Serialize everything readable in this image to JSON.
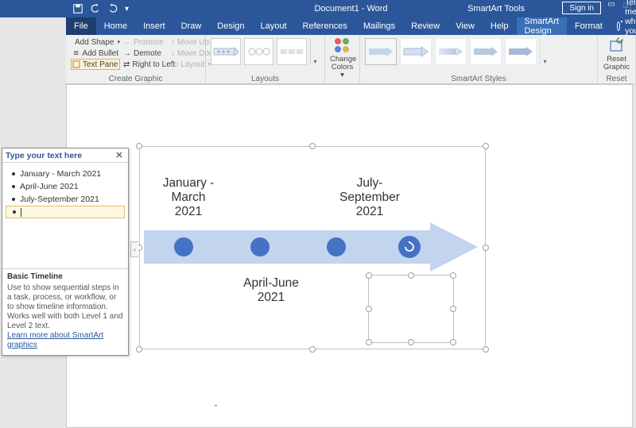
{
  "titlebar": {
    "doc_title": "Document1 - Word",
    "smartart_tools": "SmartArt Tools",
    "sign_in": "Sign in"
  },
  "tabs": {
    "file": "File",
    "items": [
      "Home",
      "Insert",
      "Draw",
      "Design",
      "Layout",
      "References",
      "Mailings",
      "Review",
      "View",
      "Help"
    ],
    "contextual": [
      "SmartArt Design",
      "Format"
    ],
    "tell_me": "Tell me what you want to do"
  },
  "ribbon": {
    "create_graphic": {
      "add_shape": "Add Shape",
      "add_bullet": "Add Bullet",
      "text_pane": "Text Pane",
      "promote": "Promote",
      "demote": "Demote",
      "right_to_left": "Right to Left",
      "move_up": "Move Up",
      "move_down": "Move Down",
      "layout": "Layout",
      "label": "Create Graphic"
    },
    "layouts_label": "Layouts",
    "change_colors": {
      "line1": "Change",
      "line2": "Colors"
    },
    "smartart_styles_label": "SmartArt Styles",
    "reset": {
      "line1": "Reset",
      "line2": "Graphic",
      "label": "Reset"
    }
  },
  "textpane": {
    "header": "Type your text here",
    "items": [
      "January - March 2021",
      "April-June 2021",
      "July-September 2021"
    ],
    "footer_title": "Basic Timeline",
    "footer_desc": "Use to show sequential steps in a task, process, or workflow, or to show timeline information. Works well with both Level 1 and Level 2 text.",
    "footer_link": "Learn more about SmartArt graphics"
  },
  "smartart": {
    "nodes": [
      {
        "line1": "January -",
        "line2": "March",
        "line3": "2021"
      },
      {
        "line1": "April-June",
        "line2": "2021"
      },
      {
        "line1": "July-",
        "line2": "September",
        "line3": "2021"
      }
    ],
    "arrow_fill": "#c3d4ee",
    "dot_fill": "#4472c4"
  }
}
